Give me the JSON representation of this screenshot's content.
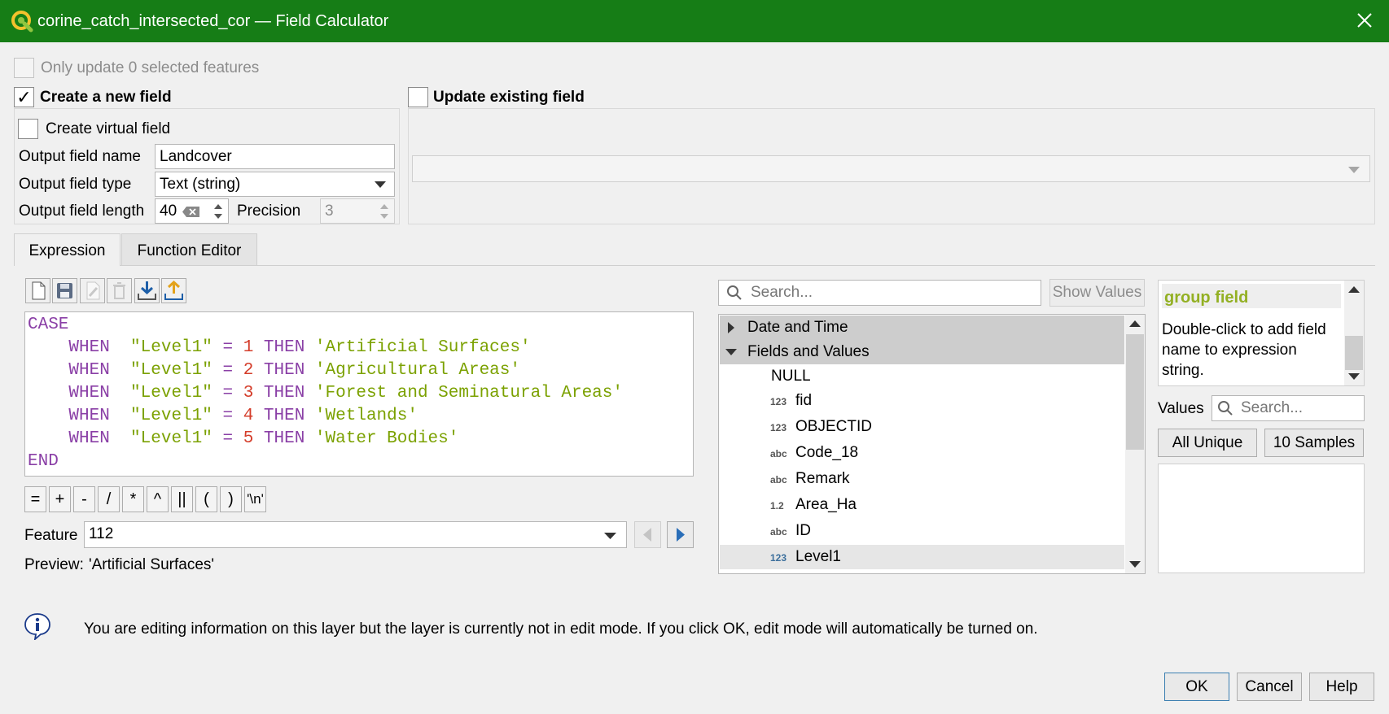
{
  "window": {
    "title": "corine_catch_intersected_cor — Field Calculator",
    "logo_icon": "qgis-logo-icon",
    "close_icon": "close-icon",
    "titlebar_color": "#167d16"
  },
  "options": {
    "only_selected_label": "Only update 0 selected features",
    "create_new_label": "Create a new field",
    "update_existing_label": "Update existing field",
    "create_virtual_label": "Create virtual field",
    "create_new_checked_mark": "✓"
  },
  "new_field": {
    "name_label": "Output field name",
    "name_value": "Landcover",
    "type_label": "Output field type",
    "type_value": "Text (string)",
    "length_label": "Output field length",
    "length_value": "40",
    "precision_label": "Precision",
    "precision_value": "3"
  },
  "tabs": [
    {
      "label": "Expression",
      "active": true
    },
    {
      "label": "Function Editor",
      "active": false
    }
  ],
  "expression_toolbar": [
    "new-file-icon",
    "save-icon",
    "edit-icon",
    "delete-icon",
    "import-icon",
    "export-icon"
  ],
  "expression": {
    "lines": [
      {
        "parts": [
          {
            "t": "CASE",
            "c": "kw"
          }
        ]
      },
      {
        "parts": [
          {
            "t": "    ",
            "c": ""
          },
          {
            "t": "WHEN",
            "c": "kw"
          },
          {
            "t": "  \"Level1\" ",
            "c": "str"
          },
          {
            "t": "=",
            "c": "op"
          },
          {
            "t": " ",
            "c": ""
          },
          {
            "t": "1",
            "c": "num"
          },
          {
            "t": " ",
            "c": ""
          },
          {
            "t": "THEN",
            "c": "kw"
          },
          {
            "t": " 'Artificial Surfaces'",
            "c": "str"
          }
        ]
      },
      {
        "parts": [
          {
            "t": "    ",
            "c": ""
          },
          {
            "t": "WHEN",
            "c": "kw"
          },
          {
            "t": "  \"Level1\" ",
            "c": "str"
          },
          {
            "t": "=",
            "c": "op"
          },
          {
            "t": " ",
            "c": ""
          },
          {
            "t": "2",
            "c": "num"
          },
          {
            "t": " ",
            "c": ""
          },
          {
            "t": "THEN",
            "c": "kw"
          },
          {
            "t": " 'Agricultural Areas'",
            "c": "str"
          }
        ]
      },
      {
        "parts": [
          {
            "t": "    ",
            "c": ""
          },
          {
            "t": "WHEN",
            "c": "kw"
          },
          {
            "t": "  \"Level1\" ",
            "c": "str"
          },
          {
            "t": "=",
            "c": "op"
          },
          {
            "t": " ",
            "c": ""
          },
          {
            "t": "3",
            "c": "num"
          },
          {
            "t": " ",
            "c": ""
          },
          {
            "t": "THEN",
            "c": "kw"
          },
          {
            "t": " 'Forest and Seminatural Areas'",
            "c": "str"
          }
        ]
      },
      {
        "parts": [
          {
            "t": "    ",
            "c": ""
          },
          {
            "t": "WHEN",
            "c": "kw"
          },
          {
            "t": "  \"Level1\" ",
            "c": "str"
          },
          {
            "t": "=",
            "c": "op"
          },
          {
            "t": " ",
            "c": ""
          },
          {
            "t": "4",
            "c": "num"
          },
          {
            "t": " ",
            "c": ""
          },
          {
            "t": "THEN",
            "c": "kw"
          },
          {
            "t": " 'Wetlands'",
            "c": "str"
          }
        ]
      },
      {
        "parts": [
          {
            "t": "    ",
            "c": ""
          },
          {
            "t": "WHEN",
            "c": "kw"
          },
          {
            "t": "  \"Level1\" ",
            "c": "str"
          },
          {
            "t": "=",
            "c": "op"
          },
          {
            "t": " ",
            "c": ""
          },
          {
            "t": "5",
            "c": "num"
          },
          {
            "t": " ",
            "c": ""
          },
          {
            "t": "THEN",
            "c": "kw"
          },
          {
            "t": " 'Water Bodies'",
            "c": "str"
          }
        ]
      },
      {
        "parts": [
          {
            "t": "END",
            "c": "kw"
          }
        ]
      }
    ],
    "colors": {
      "keyword": "#8a3fa6",
      "string": "#7ba100",
      "number": "#d43d2a"
    }
  },
  "operators": [
    "=",
    "+",
    "-",
    "/",
    "*",
    "^",
    "||",
    "(",
    ")",
    "'\\n'"
  ],
  "feature": {
    "label": "Feature",
    "value": "112"
  },
  "preview": {
    "label": "Preview:",
    "value": "'Artificial Surfaces'"
  },
  "search": {
    "placeholder": "Search...",
    "show_values_label": "Show Values"
  },
  "tree": {
    "groups": [
      {
        "label": "Date and Time",
        "expanded": false
      },
      {
        "label": "Fields and Values",
        "expanded": true
      }
    ],
    "items": [
      {
        "badge": "",
        "label": "NULL"
      },
      {
        "badge": "123",
        "label": "fid"
      },
      {
        "badge": "123",
        "label": "OBJECTID"
      },
      {
        "badge": "abc",
        "label": "Code_18"
      },
      {
        "badge": "abc",
        "label": "Remark"
      },
      {
        "badge": "1.2",
        "label": "Area_Ha"
      },
      {
        "badge": "abc",
        "label": "ID"
      },
      {
        "badge": "123",
        "label": "Level1",
        "selected": true
      }
    ]
  },
  "help_panel": {
    "title": "group field",
    "body": "Double-click to add field name to expression string.",
    "title_color": "#93b023"
  },
  "values_panel": {
    "label": "Values",
    "search_placeholder": "Search...",
    "all_unique_label": "All Unique",
    "samples_label": "10 Samples"
  },
  "info": {
    "icon": "info-icon",
    "message": "You are editing information on this layer but the layer is currently not in edit mode. If you click OK, edit mode will automatically be turned on."
  },
  "buttons": {
    "ok": "OK",
    "cancel": "Cancel",
    "help": "Help"
  }
}
